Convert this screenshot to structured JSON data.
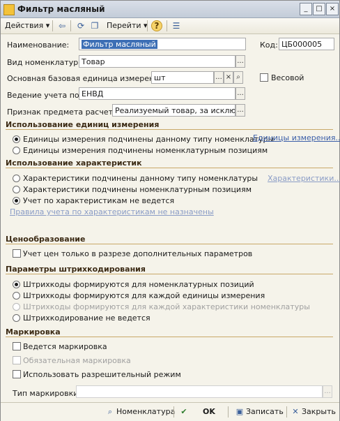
{
  "window": {
    "title": "Фильтр масляный"
  },
  "toolbar": {
    "actions_label": "Действия",
    "goto_label": "Перейти",
    "help_glyph": "?"
  },
  "fields": {
    "name_label": "Наименование:",
    "name_value": "Фильтр масляный",
    "code_label": "Код:",
    "code_value": "ЦБ000005",
    "kind_label": "Вид номенклатуры:",
    "kind_value": "Товар",
    "unit_label": "Основная базовая единица измерения:",
    "unit_value": "шт",
    "weight_label": "Весовой",
    "accounting_label": "Ведение учета по:",
    "accounting_value": "ЕНВД",
    "subject_label": "Признак предмета расчета:",
    "subject_value": "Реализуемый товар, за исключен",
    "choose_glyph": "...",
    "clear_glyph": "×"
  },
  "units_section": {
    "title": "Использование единиц измерения",
    "options": [
      "Единицы измерения подчинены данному типу номенклатуры",
      "Единицы измерения подчинены номенклатурным позициям"
    ],
    "link": "Единицы измерения..."
  },
  "characteristics_section": {
    "title": "Использование характеристик",
    "options": [
      "Характеристики подчинены данному типу номенклатуры",
      "Характеристики подчинены номенклатурным позициям",
      "Учет по характеристикам не ведется"
    ],
    "link": "Характеристики...",
    "rules_link": "Правила учета по характеристикам не назначены"
  },
  "pricing_section": {
    "title": "Ценообразование",
    "option": "Учет цен только в разрезе дополнительных параметров"
  },
  "barcode_section": {
    "title": "Параметры штрихкодирования",
    "options": [
      "Штрихкоды формируются для номенклатурных позиций",
      "Штрихкоды формируются для каждой единицы измерения",
      "Штрихкоды формируются для каждой характеристики номенклатуры",
      "Штрихкодирование не ведется"
    ]
  },
  "marking_section": {
    "title": "Маркировка",
    "options": [
      "Ведется маркировка",
      "Обязательная маркировка",
      "Использовать разрешительный режим"
    ],
    "type_label": "Тип маркировки:"
  },
  "footer": {
    "nomenclature_label": "Номенклатура",
    "ok_label": "OK",
    "save_label": "Записать",
    "close_label": "Закрыть"
  }
}
